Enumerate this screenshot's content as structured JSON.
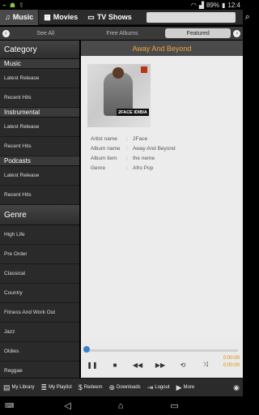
{
  "status_bar": {
    "battery": "89%",
    "time": "12:4"
  },
  "tabs": [
    {
      "label": "Music",
      "icon": "music-note-icon"
    },
    {
      "label": "Movies",
      "icon": "film-icon"
    },
    {
      "label": "TV Shows",
      "icon": "tv-icon"
    }
  ],
  "filter": {
    "see_all": "See All",
    "free_albums": "Free Albums",
    "featured": "Featured"
  },
  "sidebar": {
    "category_title": "Category",
    "sections": [
      {
        "title": "Music",
        "items": [
          "Latest Release",
          "Recent Hits"
        ]
      },
      {
        "title": "Instrumental",
        "items": [
          "Latest Release",
          "Recent Hits"
        ]
      },
      {
        "title": "Podcasts",
        "items": [
          "Latest Release",
          "Recent Hits"
        ]
      }
    ],
    "genre_title": "Genre",
    "genres": [
      "High Life",
      "Pre Order",
      "Classical",
      "Country",
      "Fitness And Work Out",
      "Jazz",
      "Oldies",
      "Reggae"
    ]
  },
  "album": {
    "title": "Away And Beyond",
    "cover_text": "2FACE IDIBIA",
    "details": [
      {
        "key": "Artist name",
        "value": "2Face"
      },
      {
        "key": "Album name",
        "value": "Away And Beyond"
      },
      {
        "key": "Album item",
        "value": "Ihe neme"
      },
      {
        "key": "Genre",
        "value": "Afro Pop"
      }
    ]
  },
  "player": {
    "elapsed": "0:00:00",
    "duration": "0:00:00",
    "progress": 0
  },
  "bottom_nav": [
    {
      "label": "My Library",
      "icon": "library-icon"
    },
    {
      "label": "My Playlist",
      "icon": "playlist-icon"
    },
    {
      "label": "Redeem",
      "icon": "dollar-icon"
    },
    {
      "label": "Downloads",
      "icon": "download-icon"
    },
    {
      "label": "Logout",
      "icon": "logout-icon"
    },
    {
      "label": "More",
      "icon": "play-circle-icon"
    }
  ]
}
